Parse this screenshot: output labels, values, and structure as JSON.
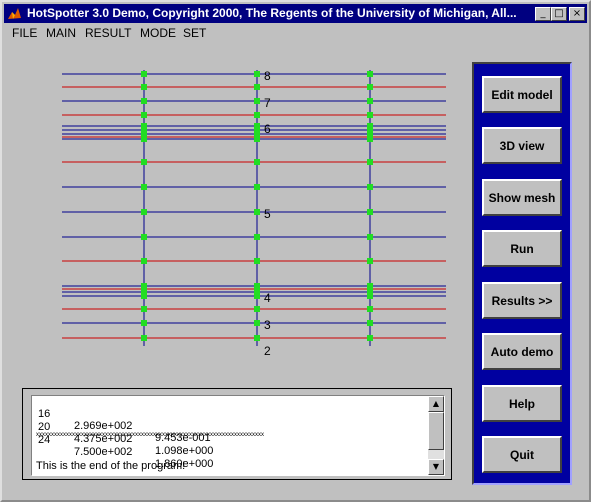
{
  "window": {
    "title": "HotSpotter 3.0 Demo,  Copyright 2000,  The Regents of the University of Michigan,  All...",
    "icon": "matlab-icon",
    "controls": {
      "minimize": "_",
      "maximize": "□",
      "close": "×"
    }
  },
  "menu": [
    "FILE",
    "MAIN",
    "RESULT",
    "MODE",
    "SET"
  ],
  "plot": {
    "labels": [
      "8",
      "7",
      "6",
      "5",
      "4",
      "3",
      "2"
    ],
    "colors": {
      "blue_line": "#00008b",
      "red_line": "#cc0000",
      "node": "#22dd22"
    }
  },
  "buttons": [
    "Edit model",
    "3D view",
    "Show mesh",
    "Run",
    "Results >>",
    "Auto demo",
    "Help",
    "Quit"
  ],
  "panel": {
    "color": "#0000a0"
  },
  "console": {
    "rows": [
      {
        "id": "16",
        "a": "2.969e+002",
        "b": "9.453e-001"
      },
      {
        "id": "20",
        "a": "4.375e+002",
        "b": "1.098e+000"
      },
      {
        "id": "24",
        "a": "7.500e+002",
        "b": "1.860e+000"
      }
    ],
    "separator": "xxxxxxxxxxxxxxxxxxxxxxxxxxxxxxxxxxxxxxxxxxxxxxxxxxxxxxxxxxxxxxxxxxxxxxxxxxxx",
    "end_message": "This is the end of the program!"
  }
}
